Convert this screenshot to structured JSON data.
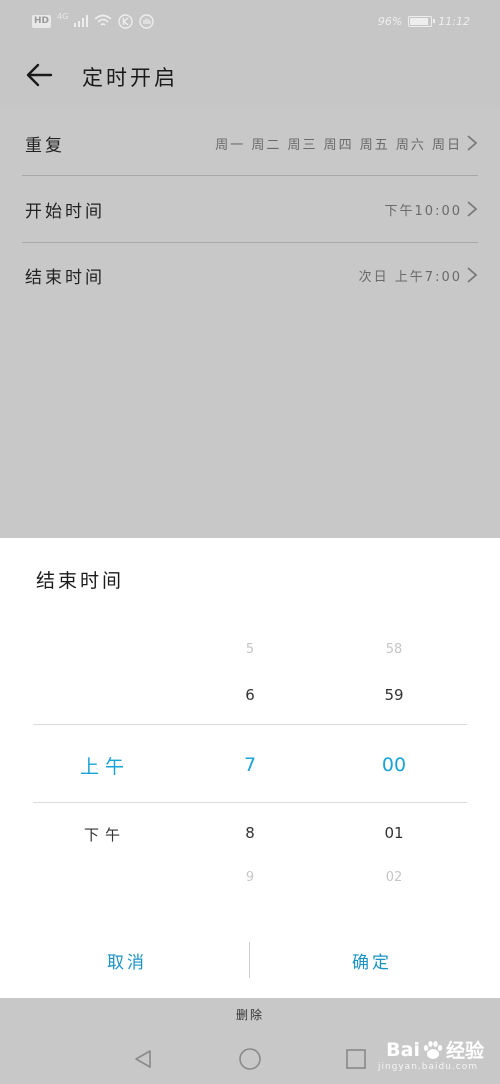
{
  "status_bar": {
    "hd": "HD",
    "network": "4G",
    "battery_text": "96%",
    "battery_level": 0.96,
    "time": "11:12"
  },
  "header": {
    "title": "定时开启"
  },
  "settings": [
    {
      "label": "重复",
      "value": "周一 周二 周三 周四 周五 周六 周日"
    },
    {
      "label": "开始时间",
      "value": "下午10:00"
    },
    {
      "label": "结束时间",
      "value": "次日 上午7:00"
    }
  ],
  "picker": {
    "title": "结束时间",
    "ampm": {
      "selected": "上午",
      "below": "下午"
    },
    "hour": {
      "above2": "5",
      "above1": "6",
      "selected": "7",
      "below1": "8",
      "below2": "9"
    },
    "minute": {
      "above2": "58",
      "above1": "59",
      "selected": "00",
      "below1": "01",
      "below2": "02"
    },
    "cancel_label": "取消",
    "confirm_label": "确定"
  },
  "bottom": {
    "delete_label": "删除"
  },
  "watermark": {
    "brand": "Bai",
    "brand_suffix": "经验",
    "url": "jingyan.baidu.com"
  },
  "colors": {
    "accent": "#1aa3d6",
    "button": "#1a92c4",
    "overlay_gray": "#c8c8c8"
  }
}
